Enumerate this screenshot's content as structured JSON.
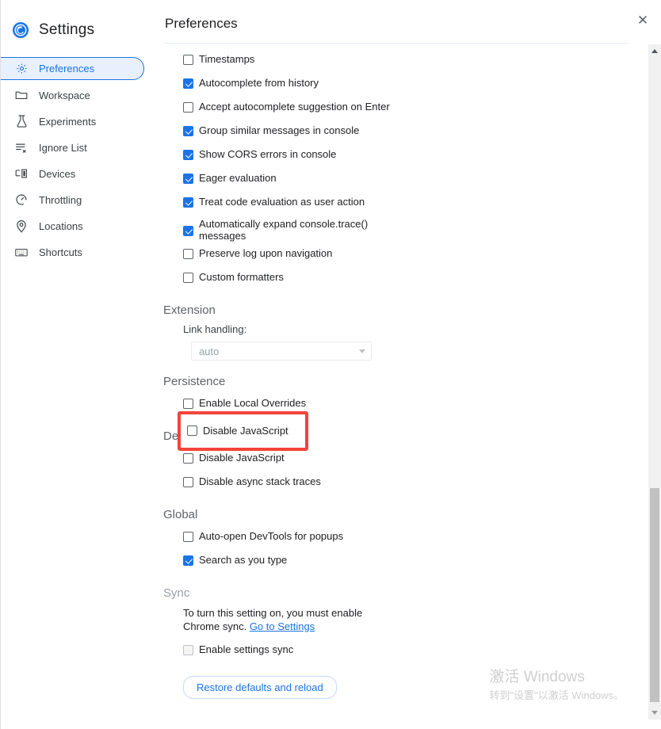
{
  "app": {
    "title": "Settings",
    "logo_icon": "chrome-logo-icon"
  },
  "sidebar": {
    "items": [
      {
        "label": "Preferences",
        "icon": "gear-icon",
        "selected": true
      },
      {
        "label": "Workspace",
        "icon": "folder-icon",
        "selected": false
      },
      {
        "label": "Experiments",
        "icon": "flask-icon",
        "selected": false
      },
      {
        "label": "Ignore List",
        "icon": "ignore-list-icon",
        "selected": false
      },
      {
        "label": "Devices",
        "icon": "devices-icon",
        "selected": false
      },
      {
        "label": "Throttling",
        "icon": "gauge-icon",
        "selected": false
      },
      {
        "label": "Locations",
        "icon": "location-pin-icon",
        "selected": false
      },
      {
        "label": "Shortcuts",
        "icon": "keyboard-icon",
        "selected": false
      }
    ]
  },
  "header": {
    "pane_title": "Preferences",
    "close_icon": "close-icon"
  },
  "console_section": {
    "checkboxes": [
      {
        "label": "Timestamps",
        "checked": false
      },
      {
        "label": "Autocomplete from history",
        "checked": true
      },
      {
        "label": "Accept autocomplete suggestion on Enter",
        "checked": false
      },
      {
        "label": "Group similar messages in console",
        "checked": true
      },
      {
        "label": "Show CORS errors in console",
        "checked": true
      },
      {
        "label": "Eager evaluation",
        "checked": true
      },
      {
        "label": "Treat code evaluation as user action",
        "checked": true
      },
      {
        "label": "Automatically expand console.trace() messages",
        "checked": true
      },
      {
        "label": "Preserve log upon navigation",
        "checked": false
      },
      {
        "label": "Custom formatters",
        "checked": false
      }
    ]
  },
  "extension_section": {
    "heading": "Extension",
    "link_handling_label": "Link handling:",
    "link_handling_value": "auto",
    "dropdown_icon": "chevron-down-icon"
  },
  "persistence_section": {
    "heading": "Persistence",
    "checkboxes": [
      {
        "label": "Enable Local Overrides",
        "checked": false
      }
    ]
  },
  "debugger_section": {
    "heading": "Debugger",
    "checkboxes": [
      {
        "label": "Disable JavaScript",
        "checked": false
      },
      {
        "label": "Disable async stack traces",
        "checked": false
      }
    ]
  },
  "global_section": {
    "heading": "Global",
    "checkboxes": [
      {
        "label": "Auto-open DevTools for popups",
        "checked": false
      },
      {
        "label": "Search as you type",
        "checked": true
      }
    ]
  },
  "sync_section": {
    "heading": "Sync",
    "note_prefix": "To turn this setting on, you must enable Chrome sync. ",
    "note_link": "Go to Settings",
    "checkbox_label": "Enable settings sync",
    "checkbox_checked": false,
    "restore_button": "Restore defaults and reload"
  },
  "scrollbar": {
    "up_arrow_icon": "scroll-up-arrow-icon",
    "down_arrow_icon": "scroll-down-arrow-icon"
  },
  "annotation": {
    "target_label": "Disable JavaScript",
    "color": "#f4433a"
  },
  "watermark": {
    "line1": "激活 Windows",
    "line2": "转到\"设置\"以激活 Windows。"
  }
}
